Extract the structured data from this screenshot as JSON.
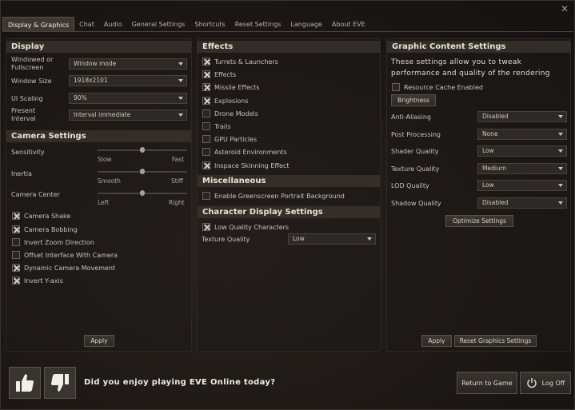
{
  "tabs": [
    {
      "label": "Display & Graphics",
      "active": true
    },
    {
      "label": "Chat"
    },
    {
      "label": "Audio"
    },
    {
      "label": "General Settings"
    },
    {
      "label": "Shortcuts"
    },
    {
      "label": "Reset Settings"
    },
    {
      "label": "Language"
    },
    {
      "label": "About EVE"
    }
  ],
  "display": {
    "header": "Display",
    "windowed_label": "Windowed or Fullscreen",
    "windowed_value": "Window mode",
    "size_label": "Window Size",
    "size_value": "1918x2101",
    "scaling_label": "UI Scaling",
    "scaling_value": "90%",
    "interval_label": "Present Interval",
    "interval_value": "Interval immediate"
  },
  "camera": {
    "header": "Camera Settings",
    "sensitivity": {
      "label": "Sensitivity",
      "min": "Slow",
      "max": "Fast",
      "value": 0.5
    },
    "inertia": {
      "label": "Inertia",
      "min": "Smooth",
      "max": "Stiff",
      "value": 0.5
    },
    "center": {
      "label": "Camera Center",
      "min": "Left",
      "max": "Right",
      "value": 0.5
    },
    "options": [
      {
        "label": "Camera Shake",
        "checked": true
      },
      {
        "label": "Camera Bobbing",
        "checked": true
      },
      {
        "label": "Invert Zoom Direction",
        "checked": false
      },
      {
        "label": "Offset Interface With Camera",
        "checked": false
      },
      {
        "label": "Dynamic Camera Movement",
        "checked": true
      },
      {
        "label": "Invert Y-axis",
        "checked": true
      }
    ],
    "apply": "Apply"
  },
  "effects": {
    "header": "Effects",
    "options": [
      {
        "label": "Turrets & Launchers",
        "checked": true
      },
      {
        "label": "Effects",
        "checked": true
      },
      {
        "label": "Missile Effects",
        "checked": true
      },
      {
        "label": "Explosions",
        "checked": true
      },
      {
        "label": "Drone Models",
        "checked": false
      },
      {
        "label": "Trails",
        "checked": false
      },
      {
        "label": "GPU Particles",
        "checked": false
      },
      {
        "label": "Asteroid Environments",
        "checked": false
      },
      {
        "label": "Inspace Skinning Effect",
        "checked": true
      }
    ]
  },
  "misc": {
    "header": "Miscellaneous",
    "options": [
      {
        "label": "Enable Greenscreen Portrait Background",
        "checked": false
      }
    ]
  },
  "character": {
    "header": "Character Display Settings",
    "low_quality": {
      "label": "Low Quality Characters",
      "checked": true
    },
    "texture_label": "Texture Quality",
    "texture_value": "Low"
  },
  "graphic": {
    "header": "Graphic Content Settings",
    "description": "These settings allow you to tweak performance and quality of the rendering",
    "resource_cache": {
      "label": "Resource Cache Enabled",
      "checked": false
    },
    "brightness": "Brightness",
    "rows": [
      {
        "label": "Anti-Aliasing",
        "value": "Disabled"
      },
      {
        "label": "Post Processing",
        "value": "None"
      },
      {
        "label": "Shader Quality",
        "value": "Low"
      },
      {
        "label": "Texture Quality",
        "value": "Medium"
      },
      {
        "label": "LOD Quality",
        "value": "Low"
      },
      {
        "label": "Shadow Quality",
        "value": "Disabled"
      }
    ],
    "optimize": "Optimize Settings",
    "apply": "Apply",
    "reset": "Reset Graphics Settings"
  },
  "bottom": {
    "question": "Did you enjoy playing EVE Online today?",
    "return": "Return to Game",
    "logoff": "Log Off"
  }
}
